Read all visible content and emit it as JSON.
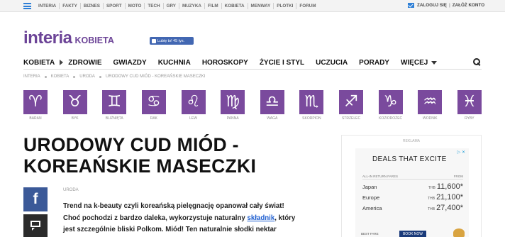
{
  "topbar": {
    "links": [
      "INTERIA",
      "FAKTY",
      "BIZNES",
      "SPORT",
      "MOTO",
      "TECH",
      "GRY",
      "MUZYKA",
      "FILM",
      "KOBIETA",
      "MENWAY",
      "PLOTKI",
      "FORUM"
    ],
    "login": "ZALOGUJ SIĘ",
    "register": "ZAŁÓŻ KONTO"
  },
  "logo": {
    "main": "interia",
    "sub": "KOBIETA"
  },
  "facebook_like": "Lubię to! 45 tys.",
  "nav": {
    "items": [
      "KOBIETA",
      "ZDROWIE",
      "GWIAZDY",
      "KUCHNIA",
      "HOROSKOPY",
      "ŻYCIE I STYL",
      "UCZUCIA",
      "PORADY",
      "WIĘCEJ"
    ]
  },
  "breadcrumb": [
    "INTERIA",
    "KOBIETA",
    "URODA",
    "URODOWY CUD MIÓD - KOREAŃSKIE MASECZKI"
  ],
  "zodiac": [
    {
      "symbol": "♈",
      "label": "BARAN"
    },
    {
      "symbol": "♉",
      "label": "BYK"
    },
    {
      "symbol": "♊",
      "label": "BLIŹNIĘTA"
    },
    {
      "symbol": "♋",
      "label": "RAK"
    },
    {
      "symbol": "♌",
      "label": "LEW"
    },
    {
      "symbol": "♍",
      "label": "PANNA"
    },
    {
      "symbol": "♎",
      "label": "WAGA"
    },
    {
      "symbol": "♏",
      "label": "SKORPION"
    },
    {
      "symbol": "♐",
      "label": "STRZELEC"
    },
    {
      "symbol": "♑",
      "label": "KOZIOROŻEC"
    },
    {
      "symbol": "♒",
      "label": "WODNIK"
    },
    {
      "symbol": "♓",
      "label": "RYBY"
    }
  ],
  "article": {
    "title_line1": "URODOWY CUD MIÓD -",
    "title_line2": "KOREAŃSKIE MASECZKI",
    "section": "URODA",
    "body_before": "Trend na k-beauty czyli koreańską pielęgnację opanował cały świat! Choć pochodzi z bardzo daleka, wykorzystuje naturalny ",
    "body_link": "składnik",
    "body_after": ", który jest szczególnie bliski Polkom. Miód! Ten naturalnie słodki nektar zapewnia"
  },
  "share": {
    "facebook_glyph": "f"
  },
  "ad": {
    "label": "REKLAMA",
    "title": "DEALS THAT EXCITE",
    "header_left": "ALL-IN RETURN FARES",
    "header_right": "FROM",
    "rows": [
      {
        "dest": "Japan",
        "cur": "THB",
        "price": "11,600*"
      },
      {
        "dest": "Europe",
        "cur": "THB",
        "price": "21,100*"
      },
      {
        "dest": "America",
        "cur": "THB",
        "price": "27,400*"
      }
    ],
    "footer": "BEST FARE",
    "book": "BOOK NOW",
    "close": "▷ ✕"
  },
  "colors": {
    "brand": "#6c4497",
    "zodiac_tile": "#7a4a9d",
    "facebook": "#3b5998",
    "link": "#1f5fd0"
  }
}
